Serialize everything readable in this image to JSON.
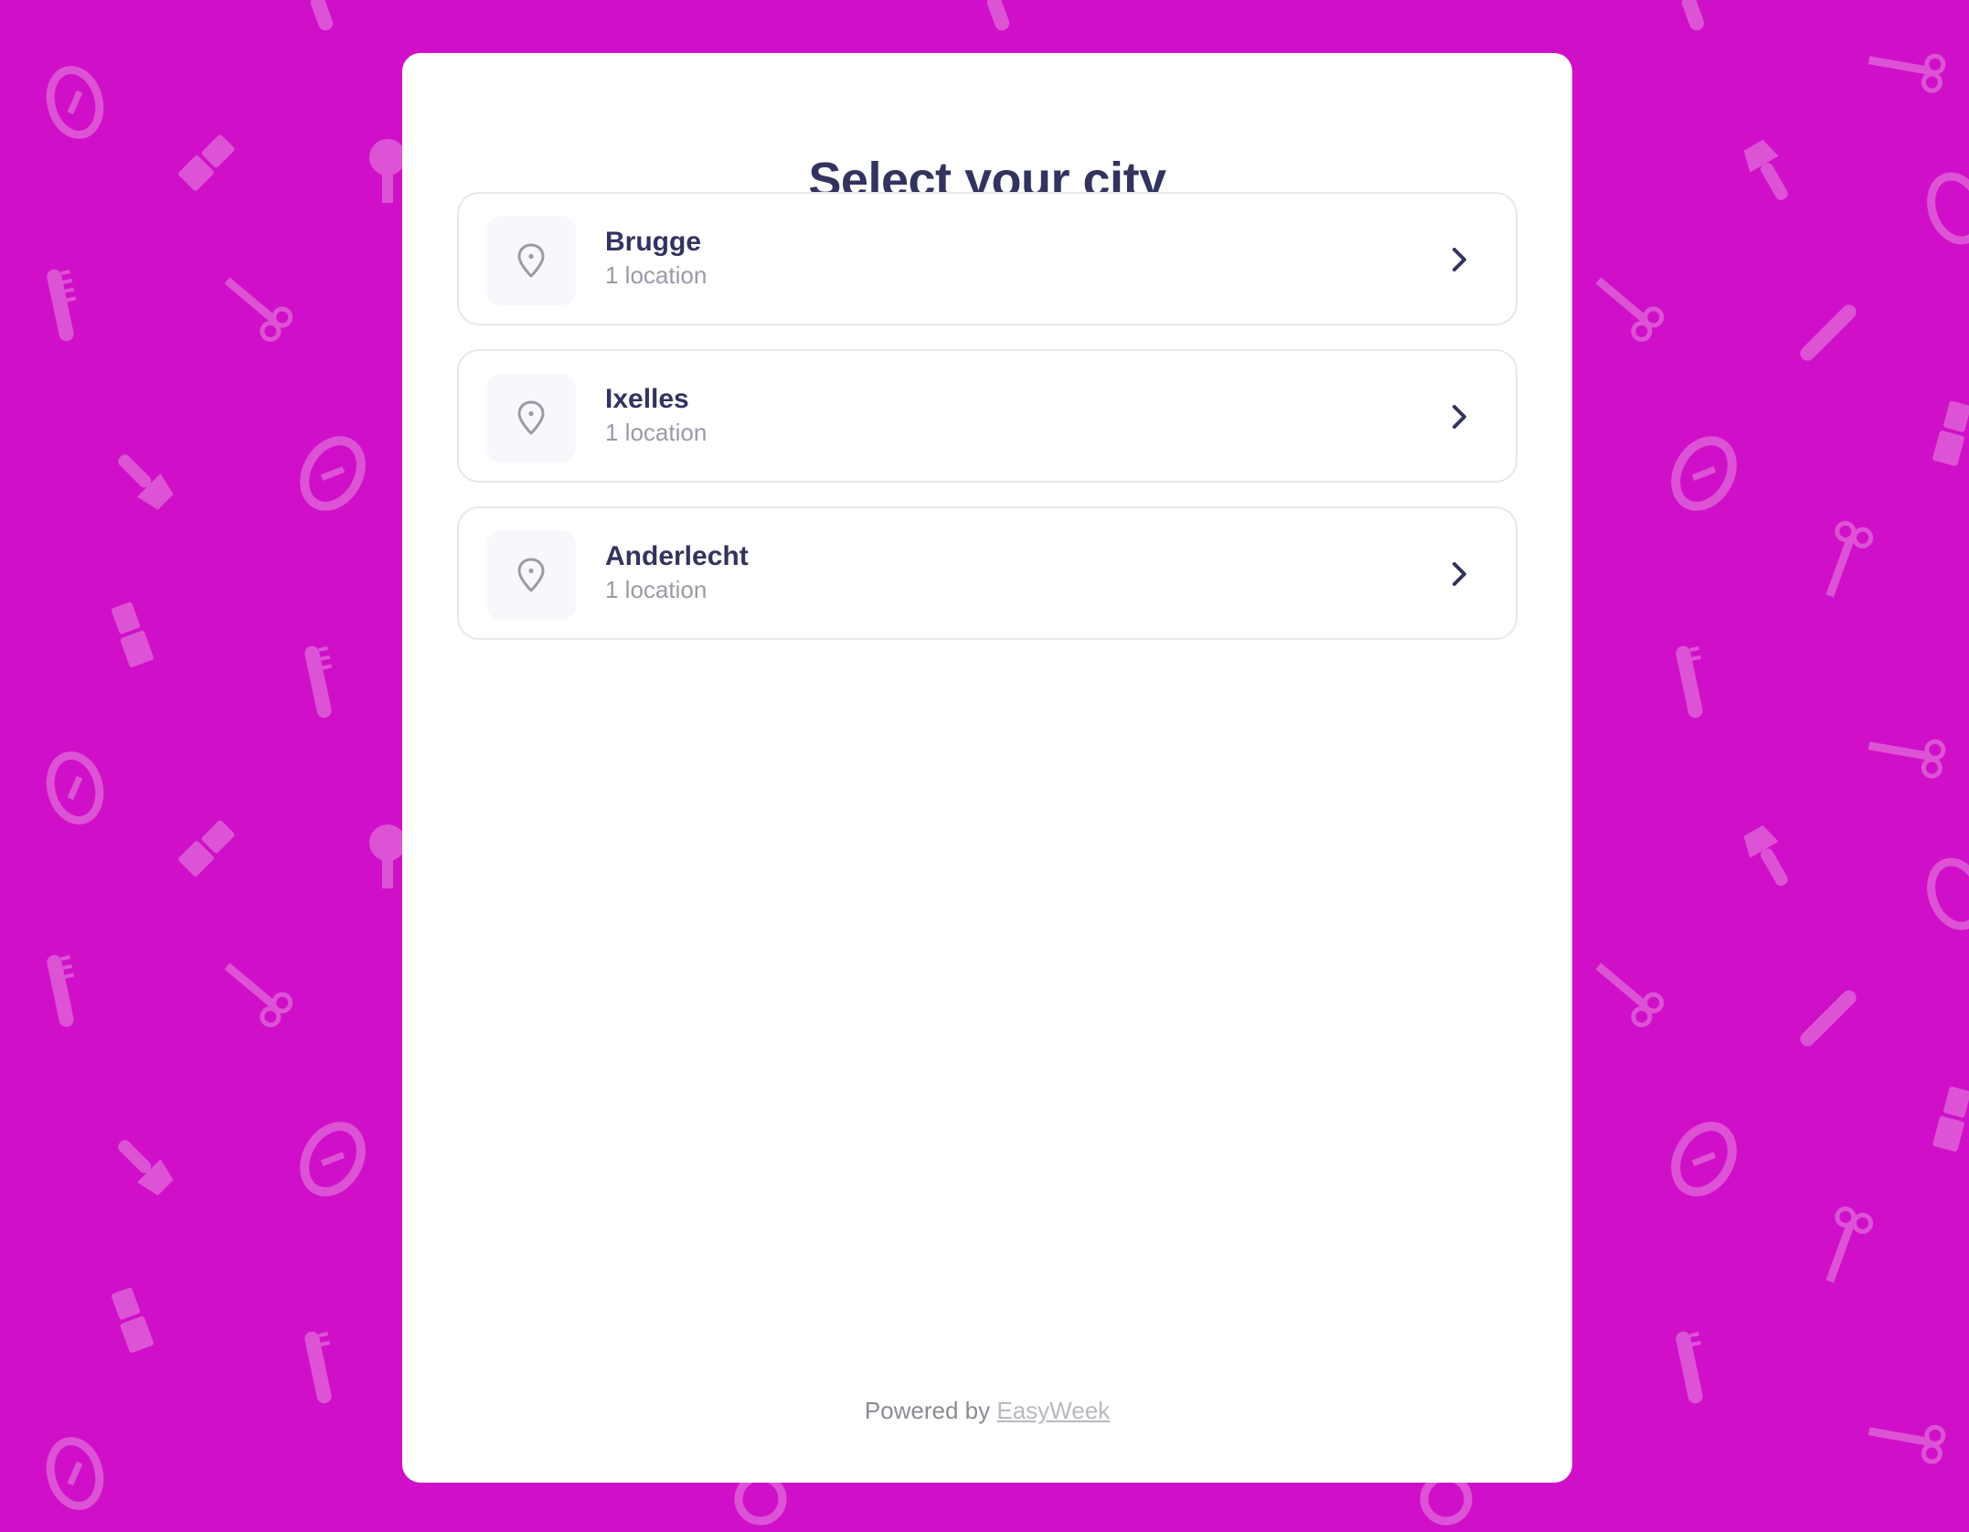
{
  "page": {
    "title": "Select your city",
    "background_color": "#d010c8",
    "accent_color": "#33335f"
  },
  "cities": [
    {
      "name": "Brugge",
      "count": "1 location",
      "icon": "location-pin-icon"
    },
    {
      "name": "Ixelles",
      "count": "1 location",
      "icon": "location-pin-icon"
    },
    {
      "name": "Anderlecht",
      "count": "1 location",
      "icon": "location-pin-icon"
    }
  ],
  "footer": {
    "prefix": "Powered by",
    "link_text": "EasyWeek"
  },
  "background_icons": [
    "scissors-icon",
    "comb-icon",
    "lipstick-icon",
    "brush-icon",
    "hair-dryer-icon",
    "soap-icon"
  ]
}
